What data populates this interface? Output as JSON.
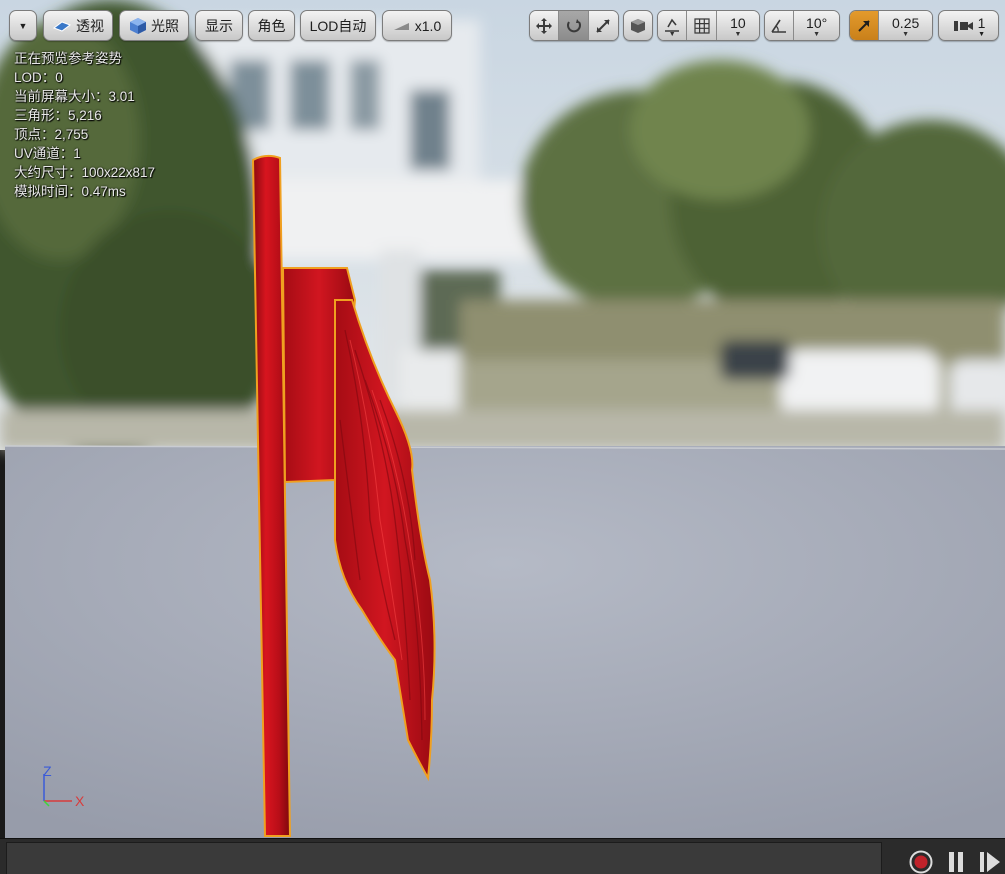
{
  "toolbar": {
    "menu_label": "",
    "perspective_label": "透视",
    "lit_label": "光照",
    "show_label": "显示",
    "character_label": "角色",
    "lod_label": "LOD自动",
    "speed_label": "x1.0",
    "grid_snap_value": "10",
    "rotate_snap_value": "10°",
    "scale_snap_value": "0.25",
    "camera_speed_value": "1"
  },
  "stats": {
    "preview_pose": "正在预览参考姿势",
    "lod": "LOD：0",
    "screen_size": "当前屏幕大小：3.01",
    "triangles": "三角形：5,216",
    "vertices": "顶点：2,755",
    "uv_channels": "UV通道：1",
    "approx_size": "大约尺寸：100x22x817",
    "sim_time": "模拟时间：0.47ms"
  },
  "axis": {
    "z": "Z",
    "x": "X"
  },
  "colors": {
    "flag": "#c8101a",
    "selection_outline": "#f0a020",
    "floor": "#a4a9b6",
    "accent_orange": "#d98c22",
    "record_red": "#c0222a"
  },
  "icons": {
    "menu": "chevron-down-icon",
    "perspective": "perspective-icon",
    "lit": "lit-cube-icon",
    "speed": "play-speed-icon",
    "translate": "translate-icon",
    "rotate": "rotate-icon",
    "scale": "scale-icon",
    "world_local": "cube-icon",
    "surface_snap": "surface-snap-icon",
    "grid": "grid-icon",
    "angle": "angle-icon",
    "scale_snap": "scale-arrow-icon",
    "camera_speed": "camera-icon",
    "record": "record-icon",
    "pause": "pause-icon",
    "step": "step-forward-icon"
  }
}
